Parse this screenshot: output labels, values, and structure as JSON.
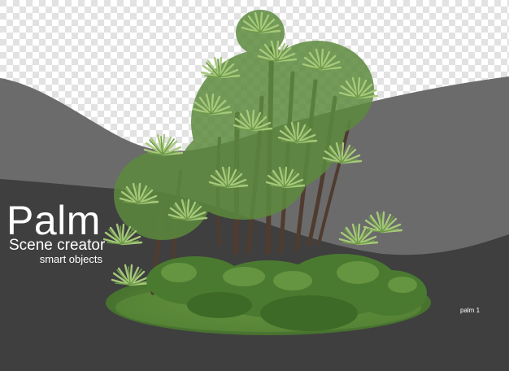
{
  "title": "Palm",
  "subtitle": "Scene creator",
  "tagline": "smart objects",
  "item_label": "palm 1",
  "colors": {
    "checker_light": "#ffffff",
    "checker_dark": "#e4e4e4",
    "band_mid": "#6a6a6a",
    "band_dark": "#3e3e3e",
    "grass": "#5c8a3c",
    "palm_leaf": "#8fb866",
    "trunk": "#5a4636"
  }
}
